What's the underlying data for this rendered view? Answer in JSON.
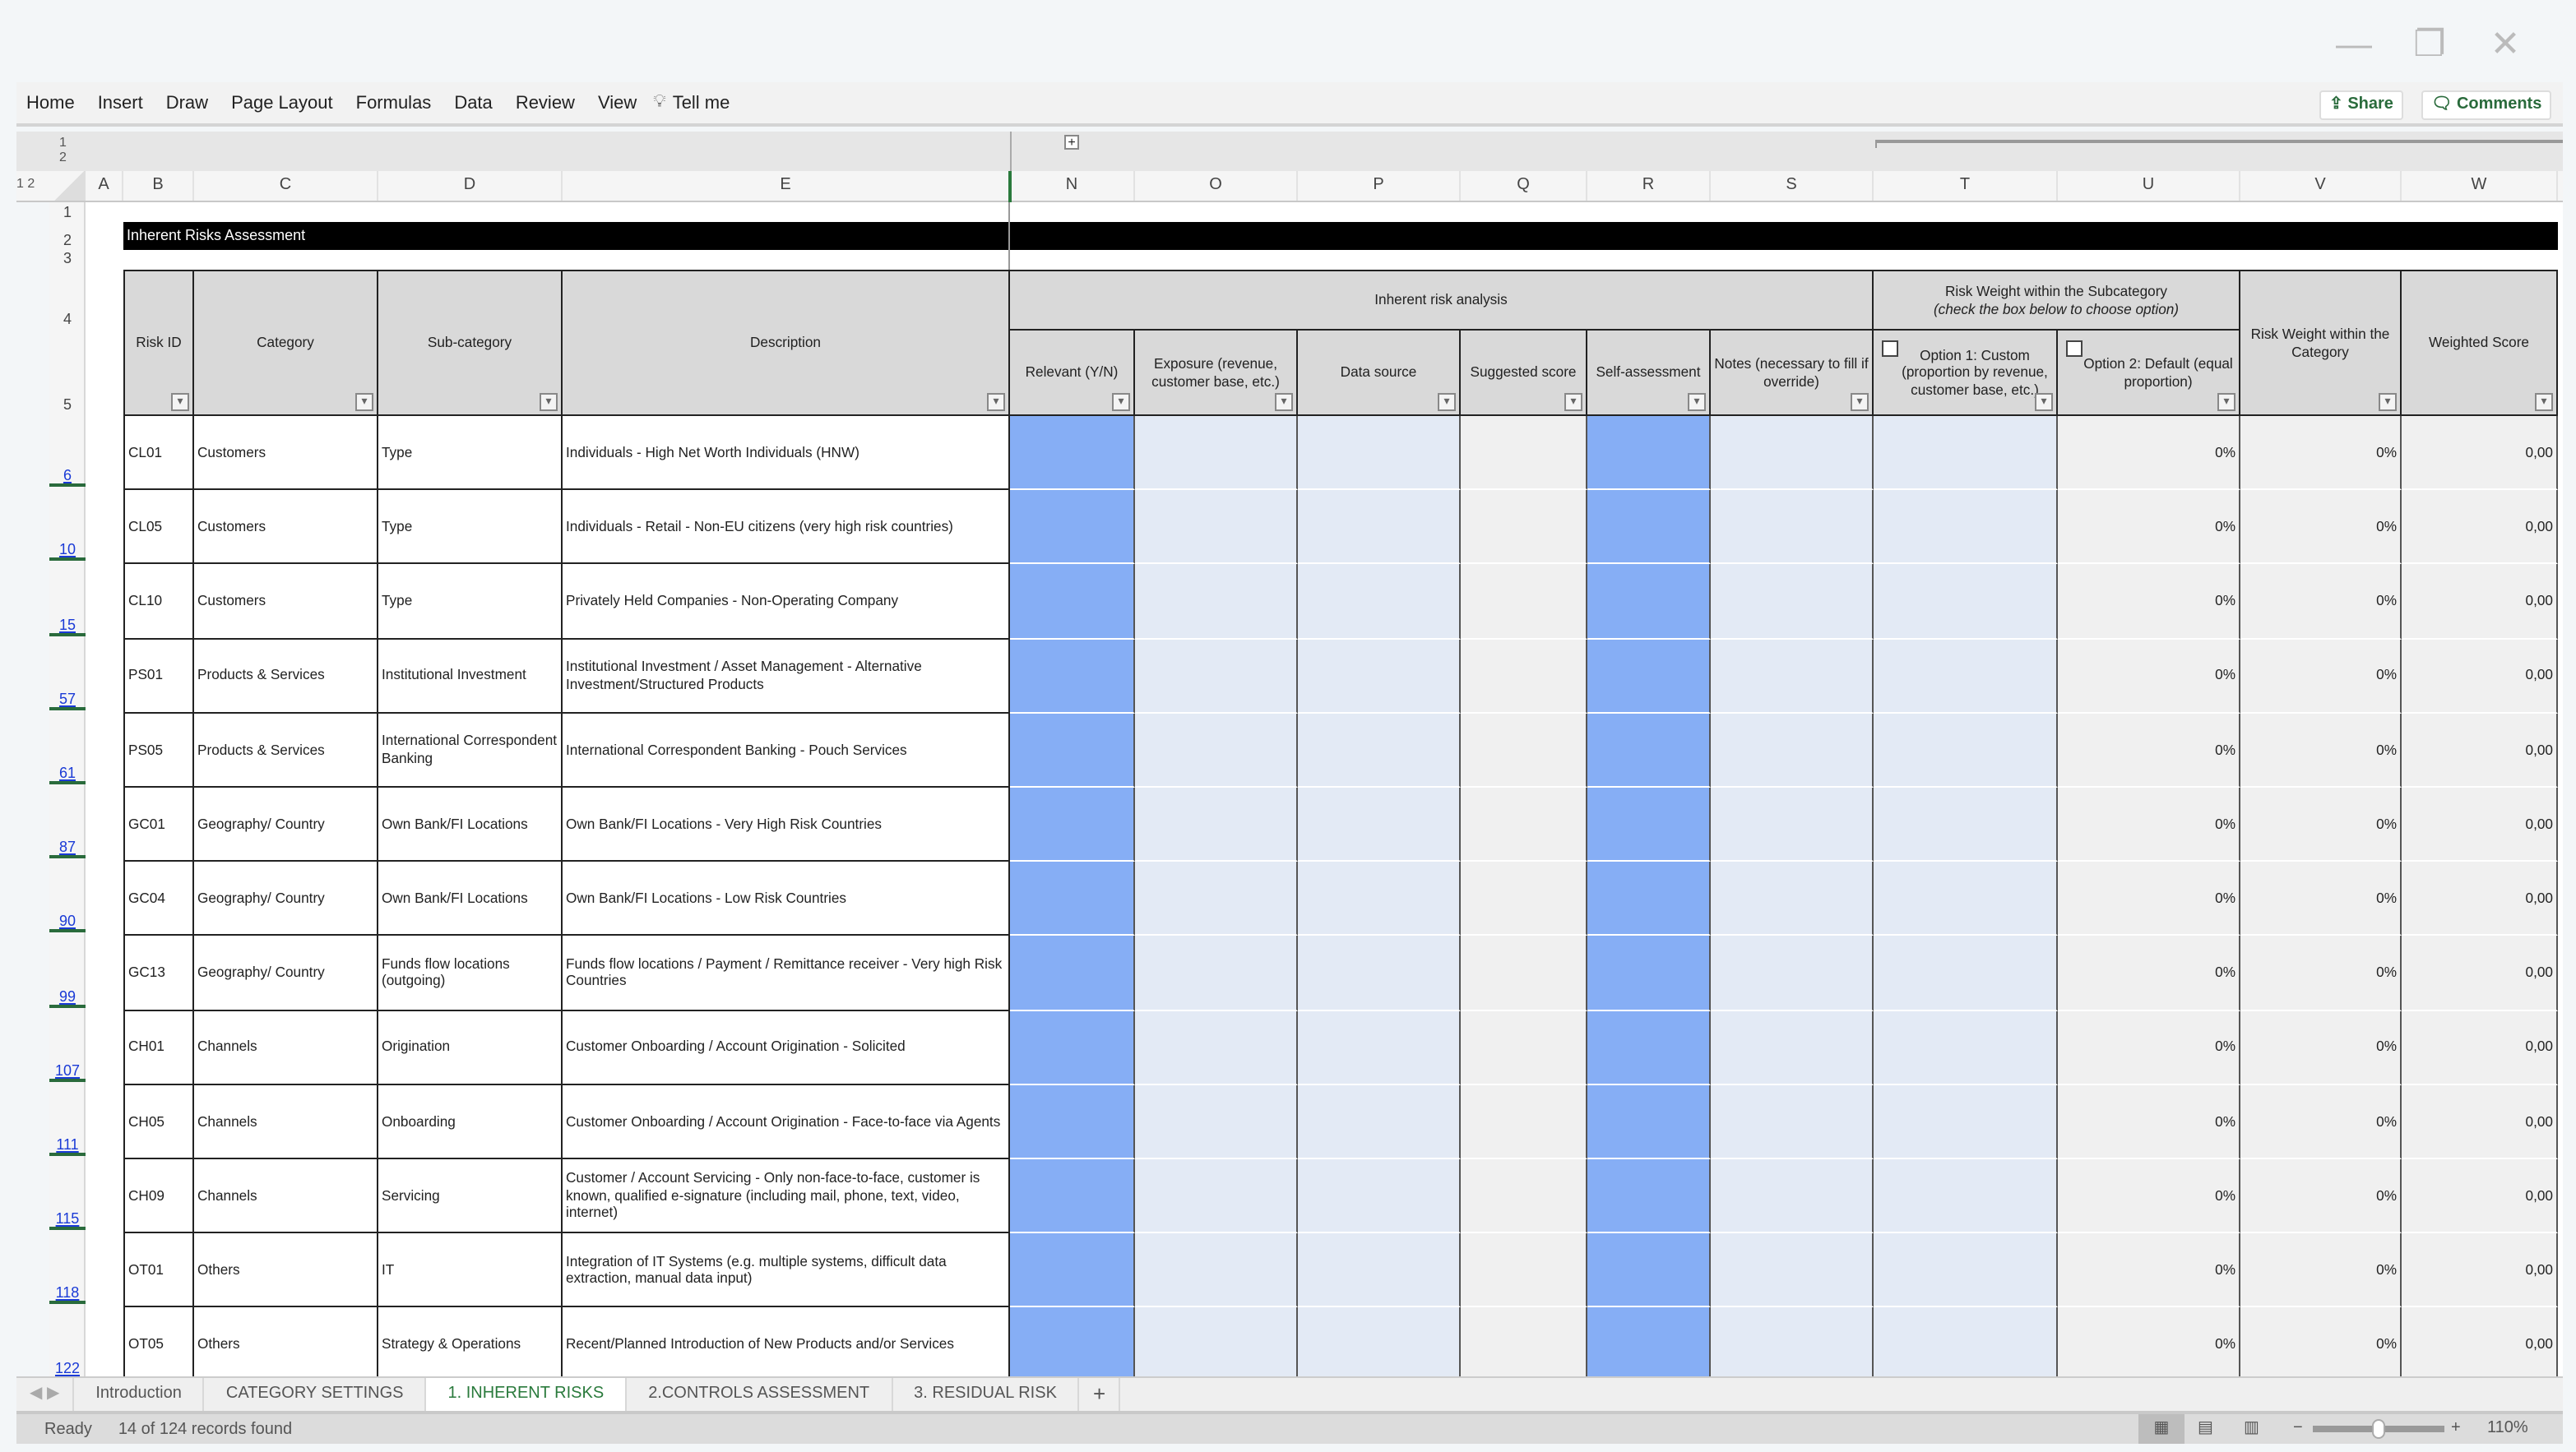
{
  "ribbon": {
    "menus": [
      "Home",
      "Insert",
      "Draw",
      "Page Layout",
      "Formulas",
      "Data",
      "Review",
      "View"
    ],
    "tell_me": "Tell me",
    "share": "Share",
    "comments": "Comments"
  },
  "outline_levels": [
    "1",
    "2"
  ],
  "columns": [
    "A",
    "B",
    "C",
    "D",
    "E",
    "N",
    "O",
    "P",
    "Q",
    "R",
    "S",
    "T",
    "U",
    "V",
    "W"
  ],
  "title_banner": "Inherent Risks Assessment",
  "header_rows": [
    "1",
    "2",
    "3",
    "4",
    "5"
  ],
  "headers": {
    "risk_id": "Risk ID",
    "category": "Category",
    "subcategory": "Sub-category",
    "description": "Description",
    "group_inherent": "Inherent risk analysis",
    "relevant": "Relevant (Y/N)",
    "exposure": "Exposure (revenue, customer base, etc.)",
    "data_source": "Data source",
    "suggested": "Suggested score",
    "self_assessment": "Self-assessment",
    "notes": "Notes (necessary to fill if override)",
    "group_weight": "Risk Weight within the Subcategory",
    "group_weight_note": "(check the box below to choose option)",
    "option1": "Option 1: Custom (proportion by revenue, customer base, etc.)",
    "option2": "Option 2: Default (equal proportion)",
    "weight_category": "Risk Weight within the Category",
    "weighted_score": "Weighted Score"
  },
  "rows": [
    {
      "row": "6",
      "id": "CL01",
      "cat": "Customers",
      "sub": "Type",
      "desc": "Individuals - High Net Worth Individuals (HNW)",
      "u": "0%",
      "v": "0%",
      "w": "0,00"
    },
    {
      "row": "10",
      "id": "CL05",
      "cat": "Customers",
      "sub": "Type",
      "desc": "Individuals - Retail - Non-EU citizens (very high risk countries)",
      "u": "0%",
      "v": "0%",
      "w": "0,00"
    },
    {
      "row": "15",
      "id": "CL10",
      "cat": "Customers",
      "sub": "Type",
      "desc": "Privately Held Companies - Non-Operating Company",
      "u": "0%",
      "v": "0%",
      "w": "0,00"
    },
    {
      "row": "57",
      "id": "PS01",
      "cat": "Products & Services",
      "sub": "Institutional Investment",
      "desc": "Institutional Investment / Asset Management - Alternative Investment/Structured Products",
      "u": "0%",
      "v": "0%",
      "w": "0,00"
    },
    {
      "row": "61",
      "id": "PS05",
      "cat": "Products & Services",
      "sub": "International Correspondent Banking",
      "desc": "International Correspondent Banking - Pouch Services",
      "u": "0%",
      "v": "0%",
      "w": "0,00"
    },
    {
      "row": "87",
      "id": "GC01",
      "cat": "Geography/ Country",
      "sub": "Own Bank/FI Locations",
      "desc": "Own Bank/FI Locations - Very High Risk Countries",
      "u": "0%",
      "v": "0%",
      "w": "0,00"
    },
    {
      "row": "90",
      "id": "GC04",
      "cat": "Geography/ Country",
      "sub": "Own Bank/FI Locations",
      "desc": "Own Bank/FI Locations - Low Risk Countries",
      "u": "0%",
      "v": "0%",
      "w": "0,00"
    },
    {
      "row": "99",
      "id": "GC13",
      "cat": "Geography/ Country",
      "sub": "Funds flow locations (outgoing)",
      "desc": "Funds flow locations / Payment / Remittance receiver - Very high Risk Countries",
      "u": "0%",
      "v": "0%",
      "w": "0,00"
    },
    {
      "row": "107",
      "id": "CH01",
      "cat": "Channels",
      "sub": "Origination",
      "desc": "Customer Onboarding / Account Origination - Solicited",
      "u": "0%",
      "v": "0%",
      "w": "0,00"
    },
    {
      "row": "111",
      "id": "CH05",
      "cat": "Channels",
      "sub": "Onboarding",
      "desc": "Customer Onboarding / Account Origination - Face-to-face via Agents",
      "u": "0%",
      "v": "0%",
      "w": "0,00"
    },
    {
      "row": "115",
      "id": "CH09",
      "cat": "Channels",
      "sub": "Servicing",
      "desc": "Customer / Account Servicing - Only non-face-to-face, customer is known, qualified e-signature (including mail, phone, text, video, internet)",
      "u": "0%",
      "v": "0%",
      "w": "0,00"
    },
    {
      "row": "118",
      "id": "OT01",
      "cat": "Others",
      "sub": "IT",
      "desc": "Integration of IT Systems (e.g. multiple systems, difficult data extraction, manual data input)",
      "u": "0%",
      "v": "0%",
      "w": "0,00"
    },
    {
      "row": "122",
      "id": "OT05",
      "cat": "Others",
      "sub": "Strategy & Operations",
      "desc": "Recent/Planned Introduction of New Products and/or Services",
      "u": "0%",
      "v": "0%",
      "w": "0,00"
    }
  ],
  "tabs": [
    "Introduction",
    "CATEGORY SETTINGS",
    "1. INHERENT RISKS",
    "2.CONTROLS ASSESSMENT",
    "3. RESIDUAL RISK"
  ],
  "active_tab": "1. INHERENT RISKS",
  "status": {
    "ready": "Ready",
    "records": "14 of 124 records found",
    "zoom": "110%"
  },
  "colors": {
    "relevant_fill": "#86aef5",
    "input_fill": "#e3eaf5",
    "calc_fill": "#f0f0f0",
    "header_fill": "#d9d9d9",
    "accent": "#2a7a3c"
  }
}
